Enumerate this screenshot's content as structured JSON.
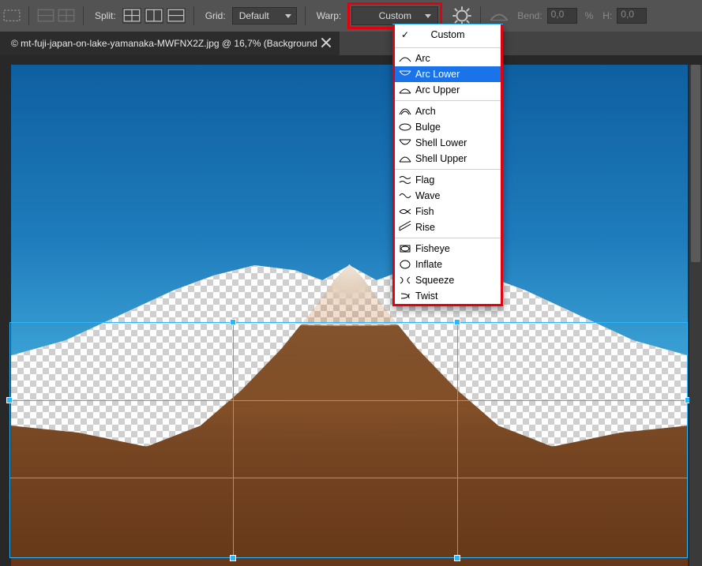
{
  "toolbar": {
    "split_label": "Split:",
    "grid_label": "Grid:",
    "grid_value": "Default",
    "warp_label": "Warp:",
    "warp_value": "Custom",
    "bend_label": "Bend:",
    "bend_value": "0,0",
    "bend_unit": "%",
    "h_label": "H:",
    "h_value": "0,0"
  },
  "doc": {
    "title": "© mt-fuji-japan-on-lake-yamanaka-MWFNX2Z.jpg @ 16,7% (Background"
  },
  "dropdown": {
    "custom": "Custom",
    "group1": [
      {
        "label": "Arc"
      },
      {
        "label": "Arc Lower"
      },
      {
        "label": "Arc Upper"
      }
    ],
    "group2": [
      {
        "label": "Arch"
      },
      {
        "label": "Bulge"
      },
      {
        "label": "Shell Lower"
      },
      {
        "label": "Shell Upper"
      }
    ],
    "group3": [
      {
        "label": "Flag"
      },
      {
        "label": "Wave"
      },
      {
        "label": "Fish"
      },
      {
        "label": "Rise"
      }
    ],
    "group4": [
      {
        "label": "Fisheye"
      },
      {
        "label": "Inflate"
      },
      {
        "label": "Squeeze"
      },
      {
        "label": "Twist"
      }
    ],
    "selected": "Arc Lower"
  }
}
